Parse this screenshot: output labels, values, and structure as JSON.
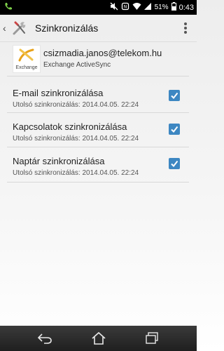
{
  "status_bar": {
    "battery": "51%",
    "time": "0:43",
    "icons": [
      "phone-icon",
      "mute-icon",
      "nfc-icon",
      "wifi-icon",
      "signal-icon",
      "battery-icon"
    ]
  },
  "action_bar": {
    "title": "Szinkronizálás",
    "icons": [
      "back-chevron-icon",
      "settings-tools-icon",
      "overflow-menu-icon"
    ]
  },
  "account": {
    "email": "csizmadia.janos@telekom.hu",
    "type": "Exchange ActiveSync",
    "logo_text": "Exchange"
  },
  "sync_items": [
    {
      "title": "E-mail szinkronizálása",
      "subtitle": "Utolsó szinkronizálás: 2014.04.05. 22:24",
      "checked": true
    },
    {
      "title": "Kapcsolatok szinkronizálása",
      "subtitle": "Utolsó szinkronizálás: 2014.04.05. 22:24",
      "checked": true
    },
    {
      "title": "Naptár szinkronizálása",
      "subtitle": "Utolsó szinkronizálás: 2014.04.05. 22:24",
      "checked": true
    }
  ],
  "nav_bar": {
    "icons": [
      "back-icon",
      "home-icon",
      "recents-icon"
    ]
  },
  "colors": {
    "accent": "#3d87c2",
    "status_bar": "#000000",
    "nav_bar": "#2a2a2a"
  }
}
